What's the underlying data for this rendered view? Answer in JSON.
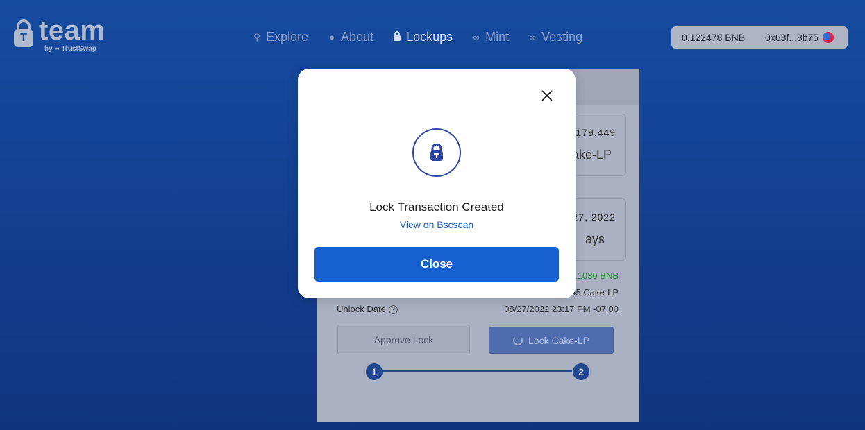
{
  "brand": {
    "name": "team",
    "by_label": "by",
    "by_brand": "TrustSwap"
  },
  "nav": [
    {
      "label": "Explore",
      "icon": "search-icon"
    },
    {
      "label": "About",
      "icon": "info-icon"
    },
    {
      "label": "Lockups",
      "icon": "lock-icon",
      "active": true
    },
    {
      "label": "Mint",
      "icon": "link-icon"
    },
    {
      "label": "Vesting",
      "icon": "link-icon"
    }
  ],
  "wallet": {
    "balance": "0.122478 BNB",
    "address": "0x63f...8b75"
  },
  "form": {
    "amount_label": ",179.449",
    "amount_token": "ake-LP",
    "date_label": "27, 2022",
    "duration": "ays",
    "fee_value": ".1030 BNB",
    "lp_value": "45 Cake-LP",
    "unlock_label": "Unlock Date",
    "unlock_value": "08/27/2022 23:17 PM -07:00",
    "approve_label": "Approve Lock",
    "lock_label": "Lock Cake-LP",
    "step1": "1",
    "step2": "2"
  },
  "modal": {
    "title": "Lock Transaction Created",
    "link": "View on Bscscan",
    "close_label": "Close"
  },
  "colors": {
    "accent": "#1660cf",
    "background": "#174b9f",
    "step": "#21488f"
  }
}
